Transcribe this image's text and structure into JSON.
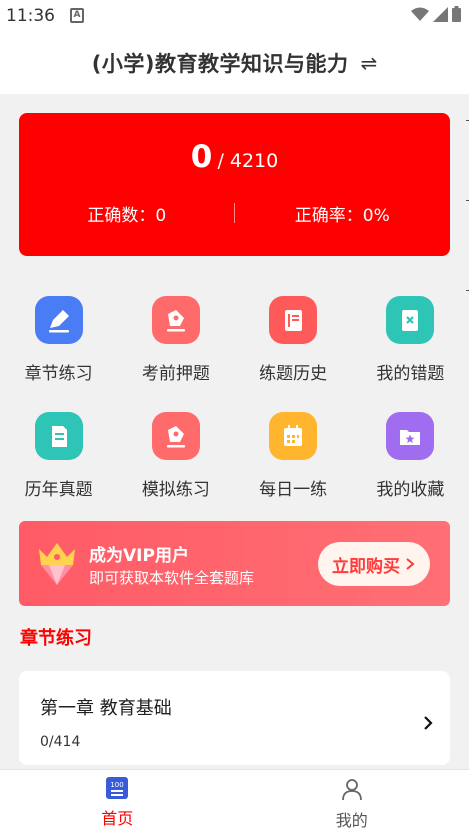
{
  "status_bar": {
    "time": "11:36",
    "a_icon_text": "A"
  },
  "header": {
    "title": "(小学)教育教学知识与能力",
    "swap_glyph": "⇌"
  },
  "stats": {
    "correct_count": "0",
    "total": "/ 4210",
    "correct_label": "正确数：0",
    "rate_label": "正确率：0%",
    "bg_color": "#ff0000"
  },
  "features": [
    {
      "label": "章节练习",
      "icon": "pencil-edit-icon",
      "color": "#4a7cf5"
    },
    {
      "label": "考前押题",
      "icon": "pen-nib-icon",
      "color": "#ff6b6b"
    },
    {
      "label": "练题历史",
      "icon": "notebook-icon",
      "color": "#ff5a5a"
    },
    {
      "label": "我的错题",
      "icon": "wrong-book-icon",
      "color": "#2ec4b6"
    },
    {
      "label": "历年真题",
      "icon": "document-icon",
      "color": "#2ec4b6"
    },
    {
      "label": "模拟练习",
      "icon": "pen-nib-icon",
      "color": "#ff6b6b"
    },
    {
      "label": "每日一练",
      "icon": "calendar-icon",
      "color": "#ffb52e"
    },
    {
      "label": "我的收藏",
      "icon": "folder-star-icon",
      "color": "#a06cf0"
    }
  ],
  "vip": {
    "title": "成为VIP用户",
    "subtitle": "即可获取本软件全套题库",
    "button": "立即购买"
  },
  "section": {
    "title": "章节练习"
  },
  "chapter": {
    "title": "第一章  教育基础",
    "progress": "0/414"
  },
  "tabs": [
    {
      "label": "首页",
      "icon": "home-100-icon",
      "active": true
    },
    {
      "label": "我的",
      "icon": "user-icon",
      "active": false
    }
  ]
}
